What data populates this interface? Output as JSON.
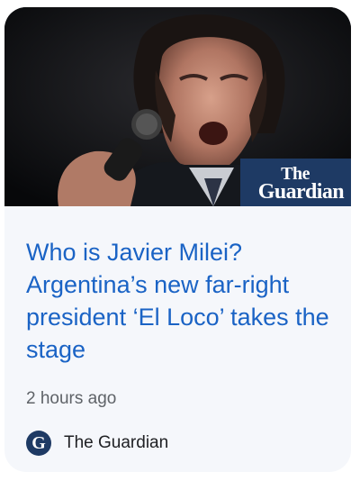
{
  "article": {
    "image_overlay": {
      "logo_line1": "The",
      "logo_line2": "Guardian"
    },
    "headline": "Who is Javier Milei? Argentina’s new far-right president ‘El Loco’ takes the stage",
    "time_ago": "2 hours ago",
    "source": {
      "icon_letter": "G",
      "name": "The Guardian"
    }
  },
  "colors": {
    "headline": "#1a63c5",
    "logo_bg": "#1e3a64",
    "card_bg": "#f5f7fb"
  }
}
